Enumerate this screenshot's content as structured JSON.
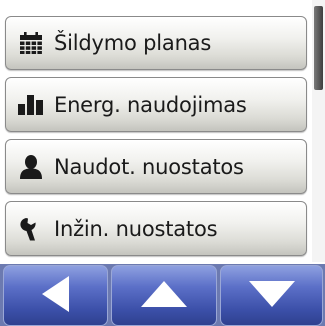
{
  "menu": {
    "items": [
      {
        "label": "Šildymo planas",
        "icon": "calendar-icon"
      },
      {
        "label": "Energ. naudojimas",
        "icon": "bar-chart-icon"
      },
      {
        "label": "Naudot. nuostatos",
        "icon": "user-icon"
      },
      {
        "label": "Inžin. nuostatos",
        "icon": "wrench-icon"
      }
    ]
  },
  "navigation": {
    "buttons": [
      {
        "action": "back",
        "icon": "arrow-left-icon"
      },
      {
        "action": "up",
        "icon": "arrow-up-icon"
      },
      {
        "action": "down",
        "icon": "arrow-down-icon"
      }
    ]
  },
  "colors": {
    "menu_text": "#1a1a1a",
    "nav_button": "#4a5fbf",
    "icon": "#1a1a1a"
  }
}
